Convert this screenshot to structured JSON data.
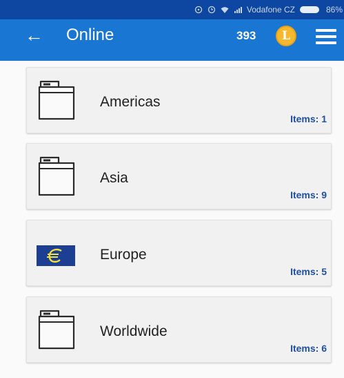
{
  "status_bar": {
    "carrier": "Vodafone CZ",
    "battery_percent": "86%",
    "icons": [
      "alarm-icon",
      "clock-icon",
      "wifi-icon",
      "signal-icon",
      "battery-icon"
    ]
  },
  "app_bar": {
    "title": "Online",
    "coin_count": "393",
    "coin_symbol": "L",
    "colors": {
      "app_bar": "#1976d2",
      "status_bar": "#0d47a1",
      "coin": "#f6b92e",
      "count_text": "#1d4fa8"
    }
  },
  "items": [
    {
      "label": "Americas",
      "count": "Items: 1",
      "icon": "folder-icon"
    },
    {
      "label": "Asia",
      "count": "Items: 9",
      "icon": "folder-icon"
    },
    {
      "label": "Europe",
      "count": "Items: 5",
      "icon": "eu-flag-icon"
    },
    {
      "label": "Worldwide",
      "count": "Items: 6",
      "icon": "folder-icon"
    }
  ]
}
